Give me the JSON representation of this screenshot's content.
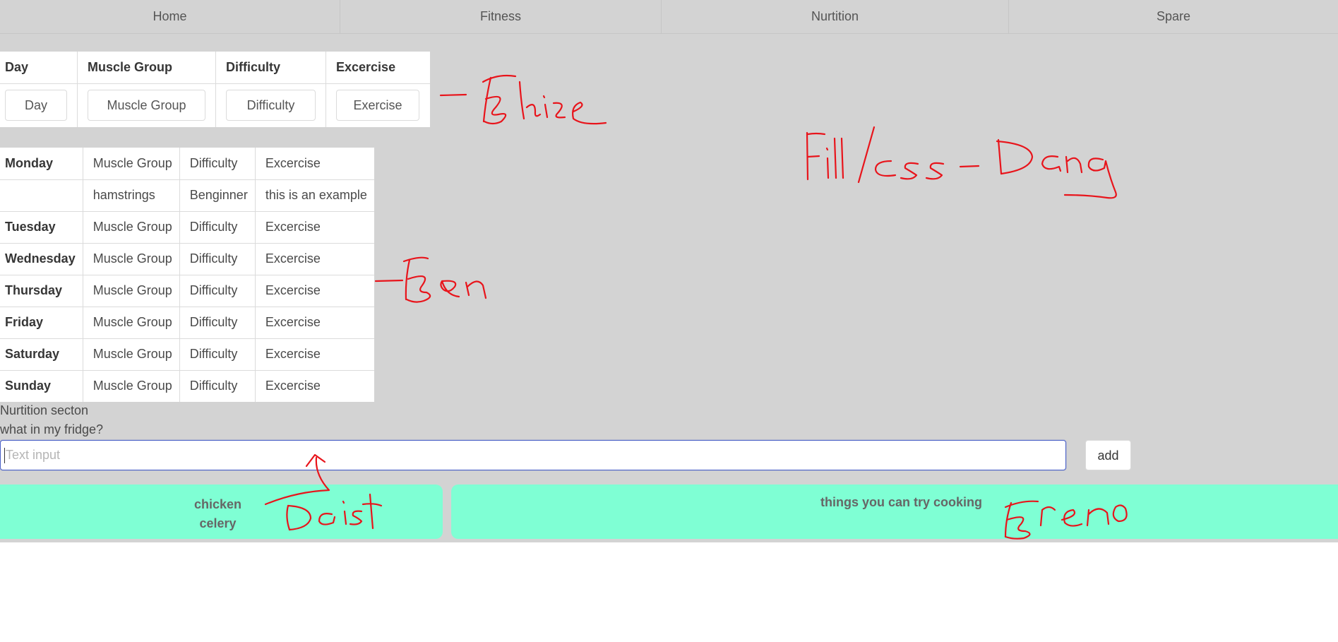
{
  "nav": {
    "items": [
      "Home",
      "Fitness",
      "Nurtition",
      "Spare"
    ]
  },
  "input_table": {
    "headers": [
      "Day",
      "Muscle Group",
      "Difficulty",
      "Excercise"
    ],
    "placeholders": [
      "Day",
      "Muscle Group",
      "Difficulty",
      "Exercise"
    ]
  },
  "week_table": {
    "rows": [
      [
        "Monday",
        "Muscle Group",
        "Difficulty",
        "Excercise"
      ],
      [
        "",
        "hamstrings",
        "Benginner",
        "this is an example"
      ],
      [
        "Tuesday",
        "Muscle Group",
        "Difficulty",
        "Excercise"
      ],
      [
        "Wednesday",
        "Muscle Group",
        "Difficulty",
        "Excercise"
      ],
      [
        "Thursday",
        "Muscle Group",
        "Difficulty",
        "Excercise"
      ],
      [
        "Friday",
        "Muscle Group",
        "Difficulty",
        "Excercise"
      ],
      [
        "Saturday",
        "Muscle Group",
        "Difficulty",
        "Excercise"
      ],
      [
        "Sunday",
        "Muscle Group",
        "Difficulty",
        "Excercise"
      ]
    ]
  },
  "nutrition": {
    "title": "Nurtition secton",
    "fridge_label": "what in my fridge?",
    "input_placeholder": "Text input",
    "add_label": "add",
    "fridge_items": [
      "chicken",
      "celery"
    ],
    "suggestions_title": "things you can try cooking"
  },
  "colors": {
    "page_background": "#d3d3d3",
    "card_background": "#7fffd4",
    "annotation_ink": "#e8141b",
    "input_focus_border": "#485fc7"
  }
}
